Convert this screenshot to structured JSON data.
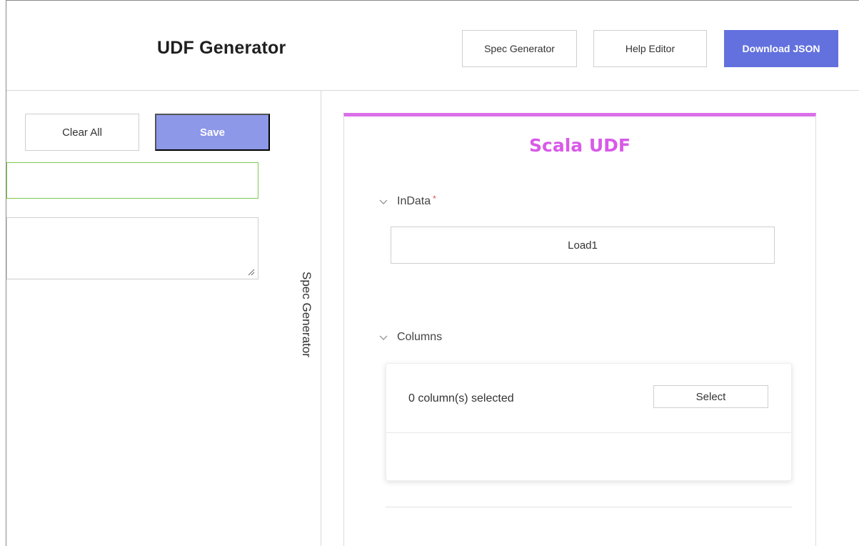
{
  "header": {
    "title": "UDF Generator",
    "spec_generator_label": "Spec Generator",
    "help_editor_label": "Help Editor",
    "download_json_label": "Download JSON"
  },
  "left_panel": {
    "clear_all_label": "Clear All",
    "save_label": "Save",
    "name_value": "",
    "description_value": "",
    "vertical_tab_label": "Spec Generator"
  },
  "card": {
    "title": "Scala UDF",
    "accent_color": "#da6fe9",
    "sections": [
      {
        "label": "InData",
        "required": true,
        "value": "Load1"
      },
      {
        "label": "Columns",
        "required": false,
        "selected_text": "0 column(s) selected",
        "select_label": "Select"
      }
    ]
  },
  "icons": [
    "chevron-down-icon",
    "resize-handle-icon"
  ],
  "colors": {
    "primary": "#6271dd",
    "primary_light": "#8e98e8",
    "valid_border": "#7ec94f",
    "required_marker": "#e05050"
  }
}
